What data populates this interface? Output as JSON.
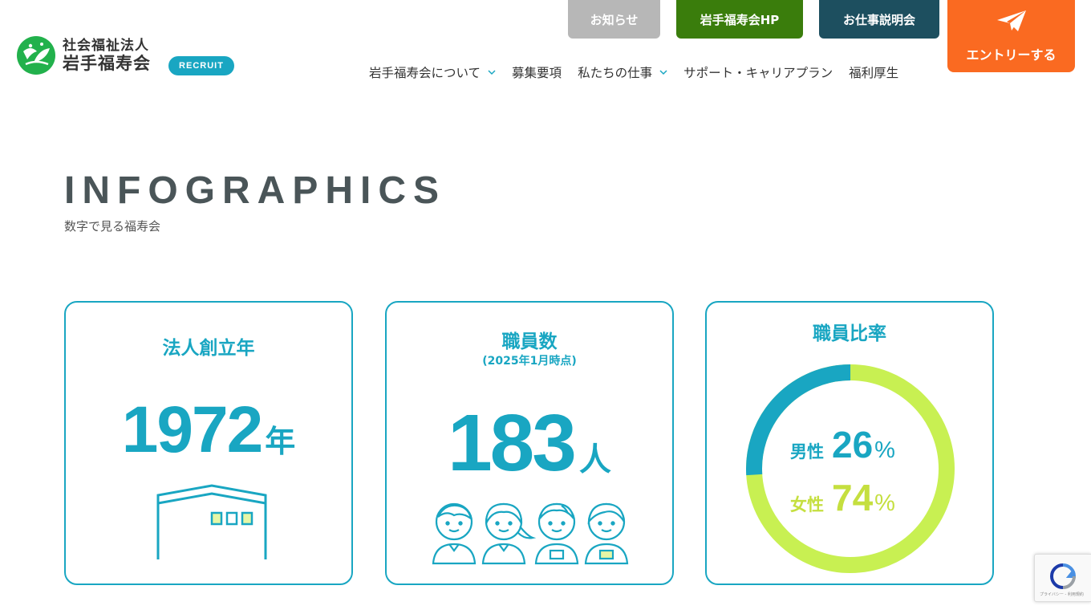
{
  "header": {
    "logo": {
      "line1": "社会福祉法人",
      "line2": "岩手福寿会",
      "icon": "leaf-emblem-icon"
    },
    "badge": "RECRUIT",
    "top_buttons": {
      "news": "お知らせ",
      "hp": "岩手福寿会HP",
      "info_session": "お仕事説明会",
      "entry": "エントリーする",
      "entry_icon": "paper-plane-icon"
    },
    "nav": [
      {
        "label": "岩手福寿会について",
        "dropdown": true
      },
      {
        "label": "募集要項",
        "dropdown": false
      },
      {
        "label": "私たちの仕事",
        "dropdown": true
      },
      {
        "label": "サポート・キャリアプラン",
        "dropdown": false
      },
      {
        "label": "福利厚生",
        "dropdown": false
      }
    ]
  },
  "hero": {
    "title": "INFOGRAPHICS",
    "subtitle": "数字で見る福寿会"
  },
  "cards": {
    "founded": {
      "title": "法人創立年",
      "value": "1972",
      "unit": "年",
      "icon": "building-icon"
    },
    "staff": {
      "title": "職員数",
      "note": "(2025年1月時点)",
      "value": "183",
      "unit": "人",
      "icon": "staff-people-icon"
    },
    "ratio": {
      "title": "職員比率",
      "male_label": "男性",
      "male_value": "26",
      "male_unit": "%",
      "female_label": "女性",
      "female_value": "74",
      "female_unit": "%",
      "male_fraction": 0.26,
      "colors": {
        "male": "#19a6c2",
        "female": "#c8f052"
      }
    }
  },
  "colors": {
    "accent": "#19a6c2",
    "entry": "#fa6a21",
    "news": "#b7b7b7",
    "hp": "#3a7d0c",
    "info_session": "#1d4f5f"
  },
  "recaptcha": {
    "text": "プライバシー - 利用規約",
    "icon": "recaptcha-icon"
  }
}
